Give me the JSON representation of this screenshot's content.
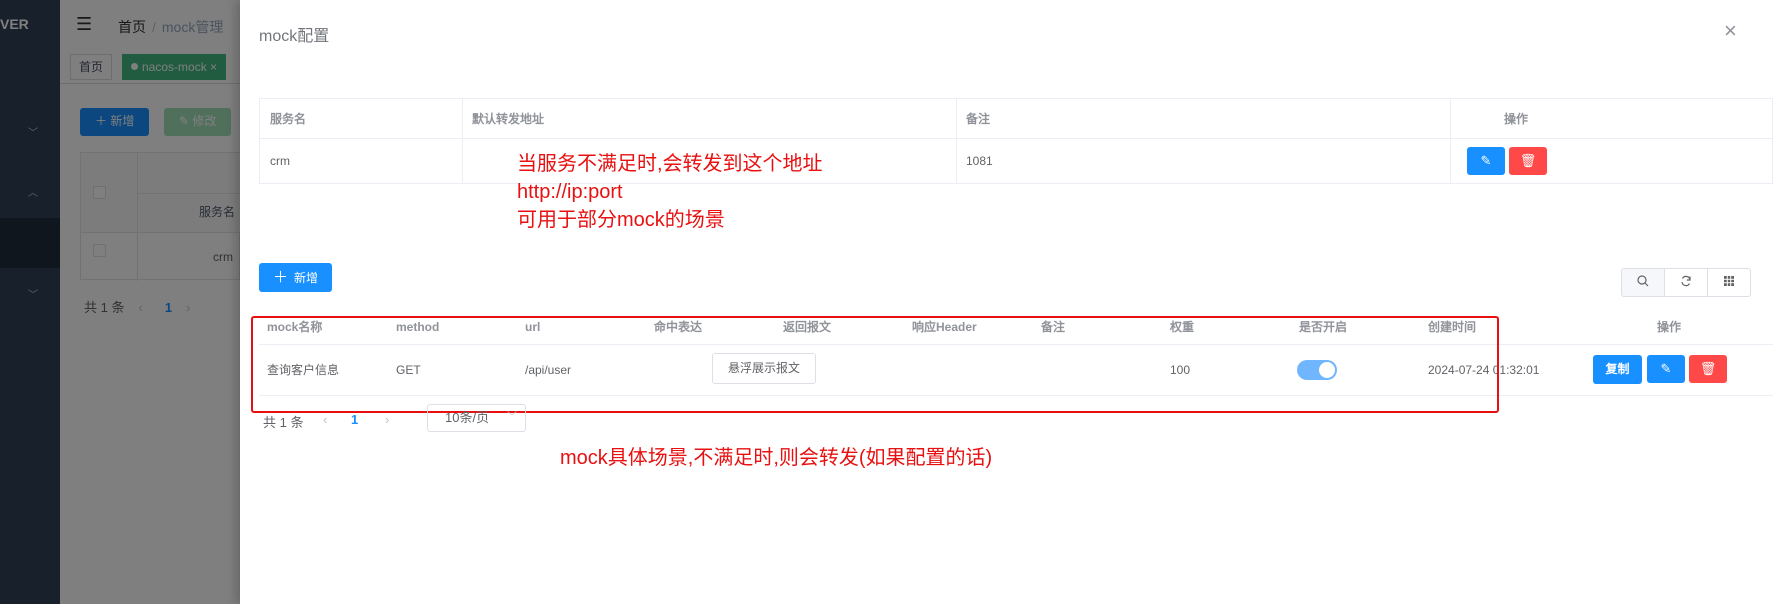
{
  "background": {
    "logo": "VER",
    "breadcrumb": {
      "home": "首页",
      "separator": "/",
      "current": "mock管理"
    },
    "tags": {
      "home": "首页",
      "active": "nacos-mock",
      "active_close": "×"
    },
    "buttons": {
      "add": "新增",
      "edit": "修改"
    },
    "table": {
      "header_service": "服务名",
      "row_service": "crm"
    },
    "pager": {
      "total": "共 1 条",
      "prev": "‹",
      "page": "1",
      "next": "›"
    }
  },
  "drawer": {
    "title": "mock配置",
    "close_icon": "×",
    "config_table": {
      "headers": [
        "服务名",
        "默认转发地址",
        "备注",
        "操作"
      ],
      "row": {
        "service": "crm",
        "forward_address": "",
        "remark": "1081"
      }
    },
    "note_forward": {
      "line1": "当服务不满足时,会转发到这个地址",
      "line2": "http://ip:port",
      "line3": "可用于部分mock的场景"
    },
    "add_button": "新增",
    "toolbar_icons": [
      "search-icon",
      "refresh-icon",
      "columns-icon"
    ],
    "mock_table": {
      "headers": [
        "mock名称",
        "method",
        "url",
        "命中表达",
        "返回报文",
        "响应Header",
        "备注",
        "权重",
        "是否开启",
        "创建时间",
        "操作"
      ],
      "row": {
        "name": "查询客户信息",
        "method": "GET",
        "url": "/api/user",
        "hit_expression": "",
        "response_button": "悬浮展示报文",
        "response_header": "",
        "remark": "",
        "weight": "100",
        "enabled": true,
        "created_at": "2024-07-24 01:32:01",
        "copy_button": "复制"
      }
    },
    "pager": {
      "total": "共 1 条",
      "prev": "‹",
      "page": "1",
      "next": "›",
      "page_size": "10条/页"
    },
    "note_mock": "mock具体场景,不满足时,则会转发(如果配置的话)"
  },
  "colors": {
    "primary": "#1890ff",
    "danger": "#ff4949",
    "annotation": "#e81010",
    "sidebar": "#304156"
  }
}
